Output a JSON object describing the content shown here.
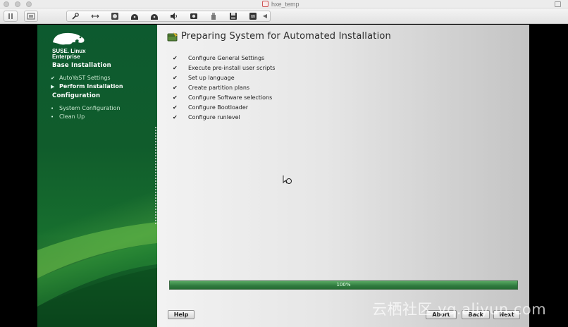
{
  "window": {
    "title": "hxe_temp"
  },
  "sidebar": {
    "brand_line1": "SUSE. Linux",
    "brand_line2": "Enterprise",
    "phase1": "Base Installation",
    "steps": [
      {
        "label": "AutoYaST Settings",
        "state": "done"
      },
      {
        "label": "Perform Installation",
        "state": "current"
      }
    ],
    "phase2": "Configuration",
    "config_steps": [
      {
        "label": "System Configuration"
      },
      {
        "label": "Clean Up"
      }
    ]
  },
  "main": {
    "title": "Preparing System for Automated Installation",
    "tasks": [
      "Configure General Settings",
      "Execute pre-install user scripts",
      "Set up language",
      "Create partition plans",
      "Configure Software selections",
      "Configure Bootloader",
      "Configure runlevel"
    ],
    "check_glyph": "✔",
    "progress": {
      "value": 1.0,
      "label": "100%"
    }
  },
  "buttons": {
    "help": "Help",
    "abort": "Abort",
    "back": "Back",
    "next": "Next"
  },
  "watermark": "云栖社区 yq.aliyun.com",
  "colors": {
    "suse_green": "#0d5a2f",
    "progress_green": "#2f7a3e"
  }
}
